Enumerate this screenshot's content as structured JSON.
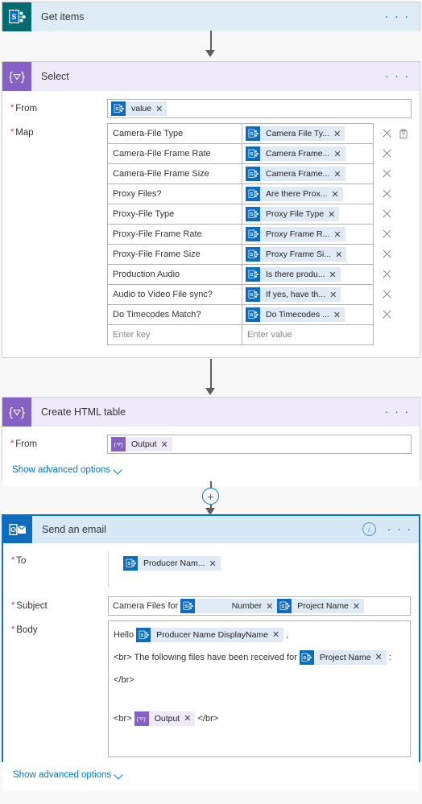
{
  "flow": {
    "steps": [
      {
        "id": "get-items",
        "title": "Get items",
        "icon": "sharepoint-icon",
        "connector_color": "#036c70",
        "more_label": "· · ·"
      },
      {
        "id": "select",
        "title": "Select",
        "icon": "data-operation-icon",
        "connector_color": "#8661c5",
        "more_label": "· · ·"
      },
      {
        "id": "create-html-table",
        "title": "Create HTML table",
        "icon": "data-operation-icon",
        "connector_color": "#8661c5",
        "more_label": "· · ·"
      },
      {
        "id": "send-an-email",
        "title": "Send an email",
        "icon": "outlook-icon",
        "connector_color": "#0f6cbd",
        "more_label": "· · ·",
        "info_label": "i"
      }
    ]
  },
  "select": {
    "from": {
      "label": "From",
      "required": true,
      "token": {
        "text": "value",
        "source": "sharepoint",
        "remove": "✕"
      }
    },
    "map": {
      "label": "Map",
      "required": true,
      "rows": [
        {
          "key": "Camera-File Type",
          "value": "Camera File Ty...",
          "source": "sharepoint"
        },
        {
          "key": "Camera-File Frame Rate",
          "value": "Camera Frame...",
          "source": "sharepoint"
        },
        {
          "key": "Camera-File Frame Size",
          "value": "Camera Frame...",
          "source": "sharepoint"
        },
        {
          "key": "Proxy Files?",
          "value": "Are there Prox...",
          "source": "sharepoint"
        },
        {
          "key": "Proxy-File Type",
          "value": "Proxy File Type",
          "source": "sharepoint"
        },
        {
          "key": "Proxy-File Frame Rate",
          "value": "Proxy Frame R...",
          "source": "sharepoint"
        },
        {
          "key": "Proxy-File Frame Size",
          "value": "Proxy Frame Si...",
          "source": "sharepoint"
        },
        {
          "key": "Production Audio",
          "value": "Is there produ...",
          "source": "sharepoint"
        },
        {
          "key": "Audio to Video File sync?",
          "value": "If yes, have th...",
          "source": "sharepoint"
        },
        {
          "key": "Do Timecodes Match?",
          "value": "Do Timecodes ...",
          "source": "sharepoint"
        }
      ],
      "new_row": {
        "key_placeholder": "Enter key",
        "value_placeholder": "Enter value"
      },
      "remove_row": "✕",
      "switch_view": "switch-to-text-mode"
    }
  },
  "create_html_table": {
    "from": {
      "label": "From",
      "required": true,
      "token": {
        "text": "Output",
        "source": "data-operation",
        "remove": "✕"
      }
    },
    "advanced_label": "Show advanced options"
  },
  "send_email": {
    "to": {
      "label": "To",
      "required": true,
      "token": {
        "text": "Producer Nam...",
        "source": "sharepoint",
        "remove": "✕"
      }
    },
    "subject": {
      "label": "Subject",
      "required": true,
      "prefix_text": "Camera Files for",
      "tokens": [
        {
          "text": "Number",
          "source": "sharepoint",
          "remove": "✕",
          "wide": true
        },
        {
          "text": "Project Name",
          "source": "sharepoint",
          "remove": "✕",
          "wide": false
        }
      ]
    },
    "body": {
      "label": "Body",
      "required": true,
      "lines": [
        {
          "segments": [
            {
              "type": "text",
              "text": "Hello "
            },
            {
              "type": "token",
              "text": "Producer Name DisplayName",
              "source": "sharepoint",
              "remove": "✕"
            },
            {
              "type": "text",
              "text": " ,"
            }
          ]
        },
        {
          "segments": [
            {
              "type": "text",
              "text": "<br> The following files have been received for "
            },
            {
              "type": "token",
              "text": "Project Name",
              "source": "sharepoint",
              "remove": "✕"
            },
            {
              "type": "text",
              "text": " :"
            }
          ]
        },
        {
          "segments": [
            {
              "type": "text",
              "text": "</br>"
            }
          ]
        },
        {
          "segments": [
            {
              "type": "text",
              "text": ""
            }
          ]
        },
        {
          "segments": [
            {
              "type": "text",
              "text": "<br> "
            },
            {
              "type": "token",
              "text": "Output",
              "source": "data-operation",
              "remove": "✕"
            },
            {
              "type": "text",
              "text": " </br>"
            }
          ]
        }
      ]
    },
    "advanced_label": "Show advanced options"
  },
  "connectors": {
    "add_step_label": "+"
  },
  "colors": {
    "sharepoint_teal": "#036c70",
    "sharepoint_blue": "#0f6cbd",
    "data_operation_purple": "#8661c5",
    "outlook_blue": "#0f6cbd",
    "accent_blue": "#0078d4",
    "required_red": "#d13438",
    "header_sp_bg": "#deecf6",
    "header_purple_bg": "#eeeaf9",
    "header_outlook_bg": "#d7e9f7"
  }
}
